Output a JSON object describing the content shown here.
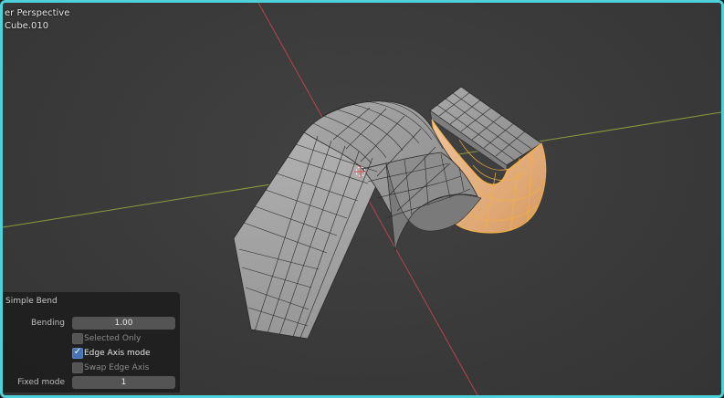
{
  "viewport": {
    "view_label": "er Perspective",
    "object_label": "Cube.010",
    "colors": {
      "background": "#3a3a3a",
      "x_axis": "#b5444c",
      "y_axis": "#8e9a3b",
      "mesh_face": "#9a9a9a",
      "mesh_wire": "#2a2a2a",
      "selected_face": "#e8a870",
      "selected_wire": "#f5b040",
      "frame_highlight": "#4fd1d9"
    }
  },
  "redo_panel": {
    "title": "Simple Bend",
    "bending_label": "Bending",
    "bending_value": "1.00",
    "selected_only": {
      "label": "Selected Only",
      "checked": false
    },
    "edge_axis_mode": {
      "label": "Edge Axis mode",
      "checked": true
    },
    "swap_edge_axis": {
      "label": "Swap Edge Axis",
      "checked": false
    },
    "fixed_mode_label": "Fixed mode",
    "fixed_mode_value": "1"
  }
}
